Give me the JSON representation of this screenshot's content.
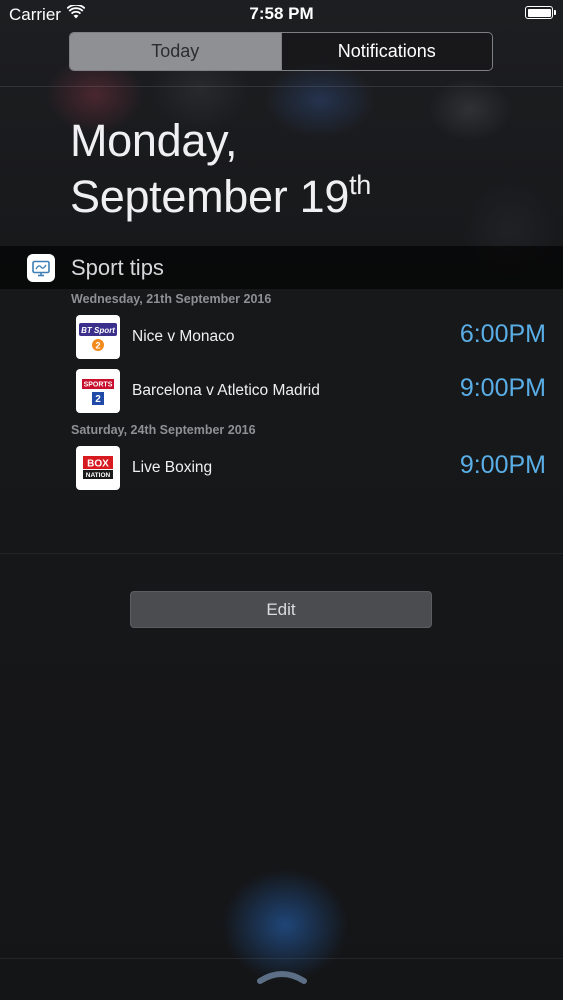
{
  "status_bar": {
    "carrier": "Carrier",
    "time": "7:58 PM",
    "wifi_icon": "wifi-icon",
    "battery_icon": "battery-full-icon"
  },
  "segmented": {
    "today_label": "Today",
    "notifications_label": "Notifications",
    "selected": "Today"
  },
  "date": {
    "line1": "Monday,",
    "line2": "September 19",
    "suffix": "th"
  },
  "widget": {
    "title": "Sport tips",
    "icon": "tv-icon"
  },
  "sections": [
    {
      "label": "Wednesday, 21th September 2016",
      "matches": [
        {
          "name": "Nice v Monaco",
          "time": "6:00PM",
          "channel_logo": "bt-sport-2-logo"
        },
        {
          "name": "Barcelona v Atletico Madrid",
          "time": "9:00PM",
          "channel_logo": "sky-sports-2-logo"
        }
      ]
    },
    {
      "label": "Saturday, 24th September 2016",
      "matches": [
        {
          "name": "Live Boxing",
          "time": "9:00PM",
          "channel_logo": "boxnation-logo"
        }
      ]
    }
  ],
  "edit_button_label": "Edit",
  "colors": {
    "accent_time": "#5aaee6",
    "segment_selected": "#8f9093",
    "background": "#161719"
  },
  "grabber_icon": "chevron-up-grabber-icon"
}
